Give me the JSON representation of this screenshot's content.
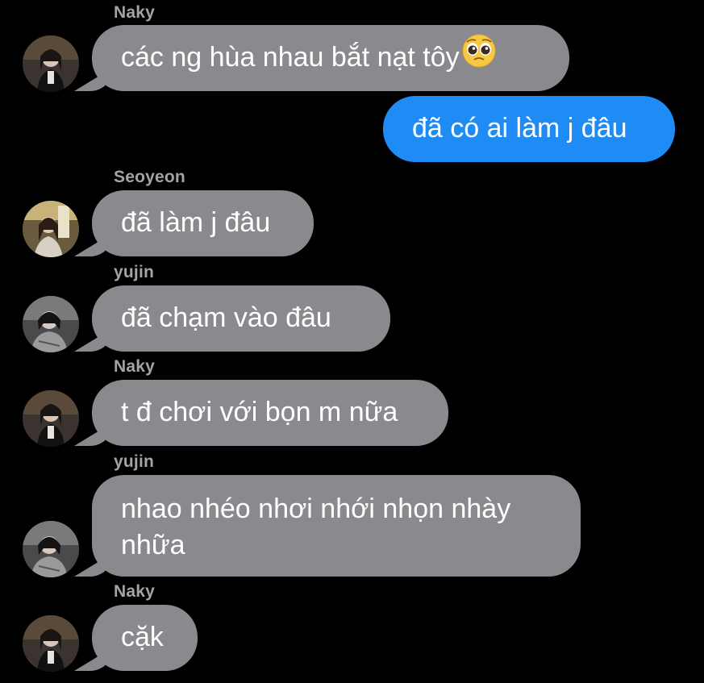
{
  "conversation": {
    "messages": [
      {
        "sender": "Naky",
        "text": "các ng hùa nhau bắt nạt tôy",
        "emoji": "pleading-face-icon",
        "direction": "in"
      },
      {
        "sender": "",
        "text": "đã có ai làm j đâu",
        "direction": "out"
      },
      {
        "sender": "Seoyeon",
        "text": "đã làm j đâu",
        "direction": "in"
      },
      {
        "sender": "yujin",
        "text": "đã chạm vào đâu",
        "direction": "in"
      },
      {
        "sender": "Naky",
        "text": "t đ chơi với bọn m nữa",
        "direction": "in"
      },
      {
        "sender": "yujin",
        "text_line1": "nhao nhéo nhơi nhới nhọn nhày",
        "text_line2": "nhữa",
        "direction": "in"
      },
      {
        "sender": "Naky",
        "text": "cặk",
        "direction": "in"
      }
    ]
  },
  "colors": {
    "background": "#000000",
    "incoming_bubble": "#8a8a8e",
    "outgoing_bubble": "#1f8cf5",
    "sender_name": "#a3a3a8"
  }
}
